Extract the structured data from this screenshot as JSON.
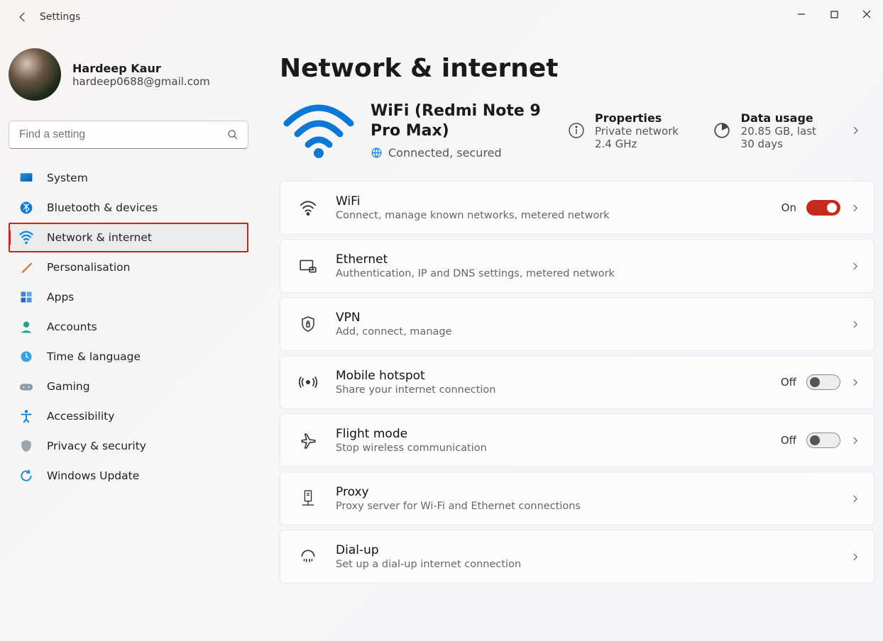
{
  "window": {
    "title": "Settings"
  },
  "user": {
    "name": "Hardeep Kaur",
    "email": "hardeep0688@gmail.com"
  },
  "search": {
    "placeholder": "Find a setting"
  },
  "nav": {
    "items": [
      {
        "label": "System"
      },
      {
        "label": "Bluetooth & devices"
      },
      {
        "label": "Network & internet"
      },
      {
        "label": "Personalisation"
      },
      {
        "label": "Apps"
      },
      {
        "label": "Accounts"
      },
      {
        "label": "Time & language"
      },
      {
        "label": "Gaming"
      },
      {
        "label": "Accessibility"
      },
      {
        "label": "Privacy & security"
      },
      {
        "label": "Windows Update"
      }
    ]
  },
  "page": {
    "title": "Network & internet",
    "network": {
      "name": "WiFi (Redmi Note 9 Pro Max)",
      "status": "Connected, secured"
    },
    "properties": {
      "title": "Properties",
      "detail": "Private network 2.4 GHz"
    },
    "data_usage": {
      "title": "Data usage",
      "detail": "20.85 GB, last 30 days"
    },
    "cards": {
      "wifi": {
        "title": "WiFi",
        "sub": "Connect, manage known networks, metered network",
        "state": "On"
      },
      "ethernet": {
        "title": "Ethernet",
        "sub": "Authentication, IP and DNS settings, metered network"
      },
      "vpn": {
        "title": "VPN",
        "sub": "Add, connect, manage"
      },
      "hotspot": {
        "title": "Mobile hotspot",
        "sub": "Share your internet connection",
        "state": "Off"
      },
      "flight": {
        "title": "Flight mode",
        "sub": "Stop wireless communication",
        "state": "Off"
      },
      "proxy": {
        "title": "Proxy",
        "sub": "Proxy server for Wi-Fi and Ethernet connections"
      },
      "dialup": {
        "title": "Dial-up",
        "sub": "Set up a dial-up internet connection"
      }
    }
  }
}
